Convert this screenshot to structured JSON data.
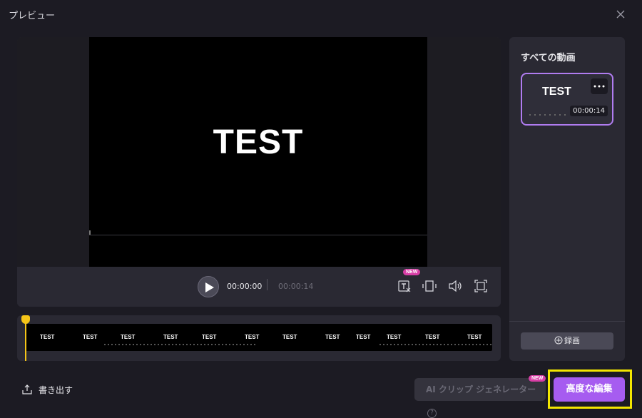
{
  "window": {
    "title": "プレビュー",
    "close_icon": "close-icon"
  },
  "preview": {
    "overlay_text": "TEST"
  },
  "controls": {
    "current_time": "00:00:00",
    "total_time": "00:00:14",
    "icons": [
      "play-icon",
      "text-icon",
      "aspect-ratio-icon",
      "volume-icon",
      "fullscreen-icon"
    ],
    "text_badge": "NEW"
  },
  "timeline": {
    "thumbnail_labels": [
      "TEST",
      "TEST",
      "TEST",
      "TEST",
      "TEST",
      "TEST",
      "TEST",
      "TEST",
      "TEST",
      "TEST",
      "TEST",
      "TEST"
    ]
  },
  "sidebar": {
    "title": "すべての動画",
    "clip": {
      "title": "TEST",
      "duration": "00:00:14"
    },
    "record_label": "録画"
  },
  "footer": {
    "export_label": "書き出す",
    "ai_clip_label": "AI クリップ ジェネレーター",
    "ai_clip_help": "?",
    "ai_badge": "NEW",
    "advanced_edit_label": "高度な編集"
  },
  "colors": {
    "accent": "#a65cf0",
    "highlight": "#f3e600",
    "playhead": "#f5c518",
    "badge": "#d83ea6"
  }
}
